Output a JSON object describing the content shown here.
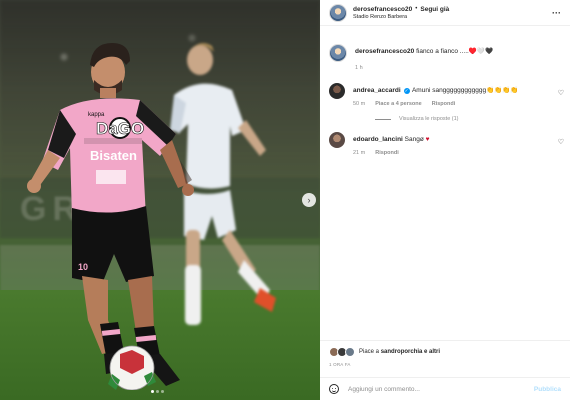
{
  "post": {
    "username": "derosefrancesco20",
    "follow_label": "Segui già",
    "separator": "•",
    "location": "Stadio Renzo Barbera",
    "more_icon": "more-horizontal-icon",
    "caption_user": "derosefrancesco20",
    "caption_text": "fianco a fianco .....♥️🤍🖤",
    "caption_time": "1 h",
    "image_nav_icon": "chevron-right-icon",
    "carousel_dots": 3,
    "carousel_active": 1,
    "photo_text": {
      "sponsor": "DaGO",
      "kit_brand": "kappa",
      "shirt_sponsor": "Bisaten",
      "number": "10"
    }
  },
  "comments": [
    {
      "username": "andrea_accardi",
      "verified": true,
      "text": "Amuni sangggggggggggg👏👏👏👏",
      "time": "50 m",
      "likes": "Piace a 4 persone",
      "reply_label": "Rispondi",
      "view_replies": "Visualizza le risposte (1)",
      "avatar_color": "#2b2b2b"
    },
    {
      "username": "edoardo_lancini",
      "verified": false,
      "text": "Sangø",
      "heart": "♥",
      "time": "21 m",
      "reply_label": "Rispondi",
      "avatar_color": "#5a4a45"
    }
  ],
  "footer": {
    "likes_prefix": "Piace a",
    "likes_user": "sandroporchia",
    "likes_suffix": "e altri",
    "time_ago": "1 ORA FA",
    "comment_placeholder": "Aggiungi un commento...",
    "publish_label": "Pubblica"
  },
  "colors": {
    "accent_blue": "#0095f6",
    "publish_disabled": "#b2dffc",
    "heart_red": "#d10f2f",
    "kit_pink": "#f2a7c8",
    "kit_black": "#111111"
  }
}
